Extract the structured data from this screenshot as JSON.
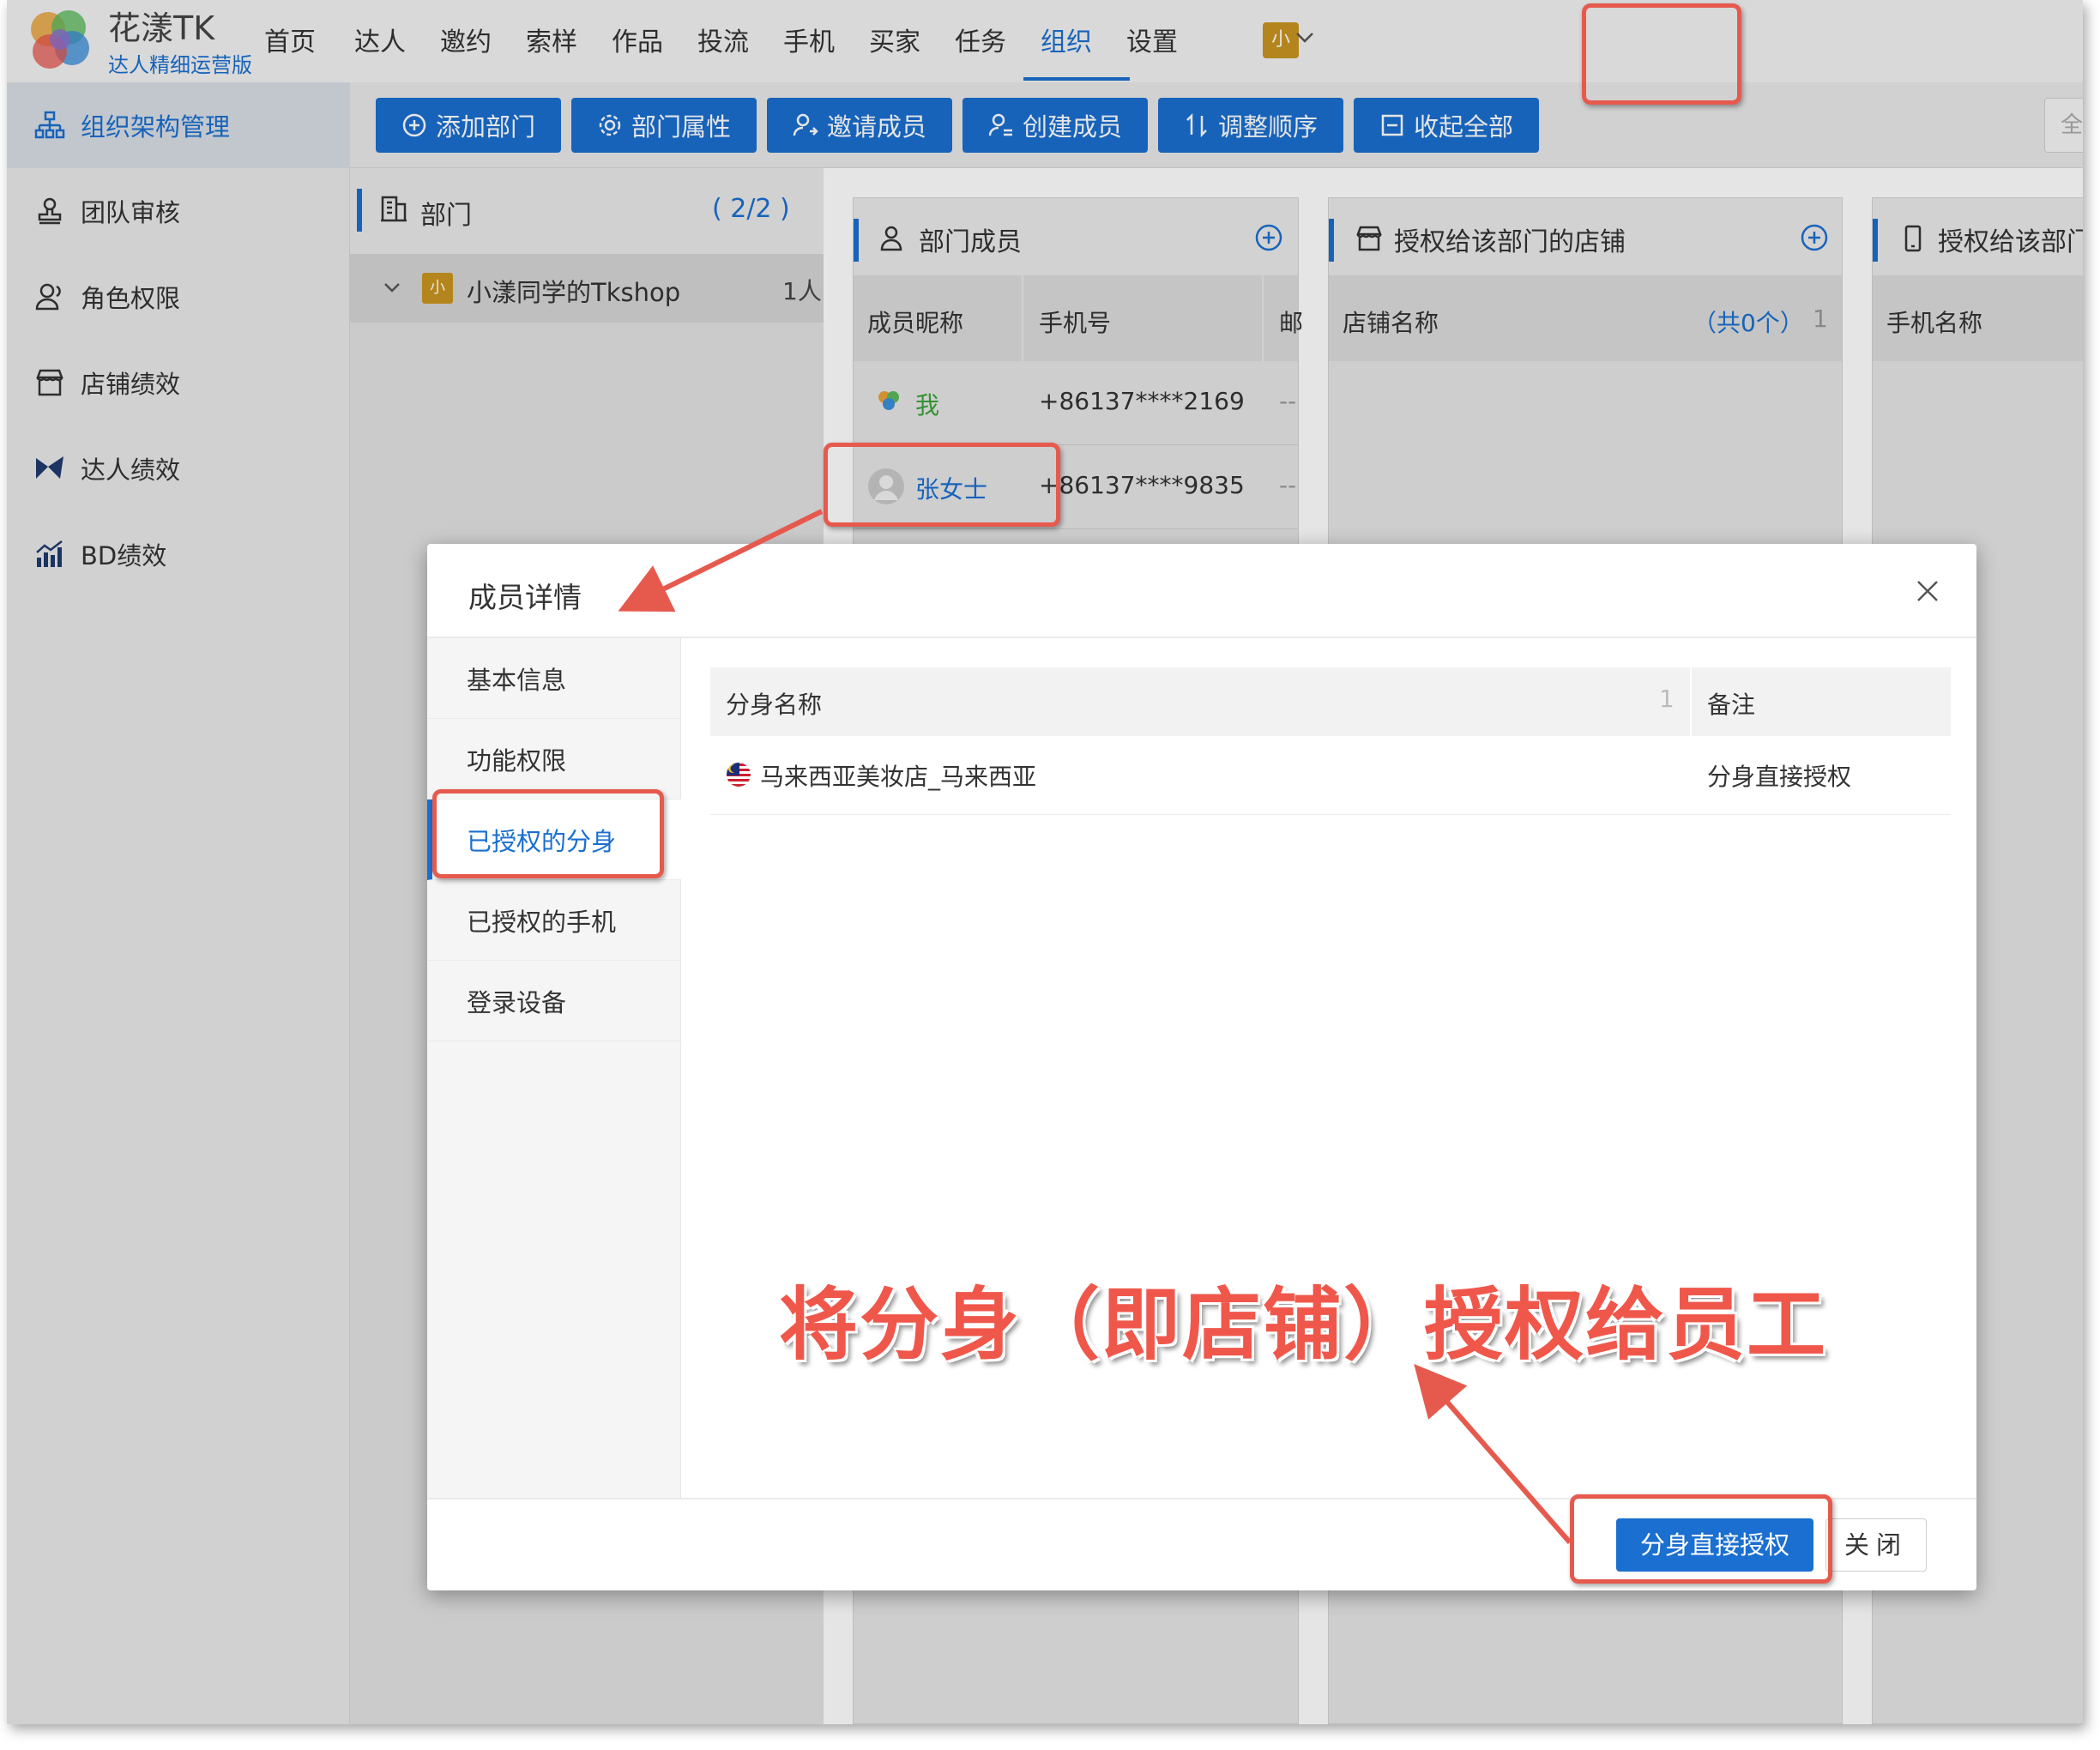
{
  "app": {
    "name": "花漾TK",
    "subtitle": "达人精细运营版"
  },
  "nav": {
    "items": [
      "首页",
      "达人",
      "邀约",
      "索样",
      "作品",
      "投流",
      "手机",
      "买家",
      "任务",
      "组织",
      "设置"
    ],
    "active": "组织",
    "user_avatar": "小"
  },
  "sidebar": {
    "items": [
      {
        "label": "组织架构管理",
        "icon": "org-chart-icon",
        "active": true
      },
      {
        "label": "团队审核",
        "icon": "stamp-icon"
      },
      {
        "label": "角色权限",
        "icon": "user-role-icon"
      },
      {
        "label": "店铺绩效",
        "icon": "shop-icon"
      },
      {
        "label": "达人绩效",
        "icon": "bowtie-icon"
      },
      {
        "label": "BD绩效",
        "icon": "bar-chart-icon"
      }
    ]
  },
  "toolbar": {
    "buttons": [
      "添加部门",
      "部门属性",
      "邀请成员",
      "创建成员",
      "调整顺序",
      "收起全部"
    ],
    "right_stub": "全"
  },
  "dept_panel": {
    "title": "部门",
    "count": "( 2/2 )",
    "row": {
      "badge": "小",
      "name": "小漾同学的Tkshop",
      "members": "1人"
    }
  },
  "members_panel": {
    "title": "部门成员",
    "columns": [
      "成员昵称",
      "手机号",
      "邮"
    ],
    "rows": [
      {
        "name": "我",
        "phone": "+86137****2169",
        "extra": "--"
      },
      {
        "name": "张女士",
        "phone": "+86137****9835",
        "extra": "--"
      }
    ]
  },
  "shops_panel": {
    "title": "授权给该部门的店铺",
    "column": "店铺名称",
    "count": "（共0个）",
    "sort": "1"
  },
  "phones_panel": {
    "title": "授权给该部门",
    "column": "手机名称"
  },
  "modal": {
    "title": "成员详情",
    "tabs": [
      "基本信息",
      "功能权限",
      "已授权的分身",
      "已授权的手机",
      "登录设备"
    ],
    "active_tab": "已授权的分身",
    "table": {
      "col1": "分身名称",
      "col1_sort": "1",
      "col2": "备注",
      "rows": [
        {
          "name": "马来西亚美妆店_马来西亚",
          "note": "分身直接授权",
          "flag": "malaysia-flag-icon"
        }
      ]
    },
    "primary_button": "分身直接授权",
    "close_button": "关闭"
  },
  "annotation": {
    "caption": "将分身（即店铺）授权给员工"
  },
  "colors": {
    "accent": "#1a6fd0",
    "highlight": "#e65a4e",
    "caption": "#f0574b"
  }
}
